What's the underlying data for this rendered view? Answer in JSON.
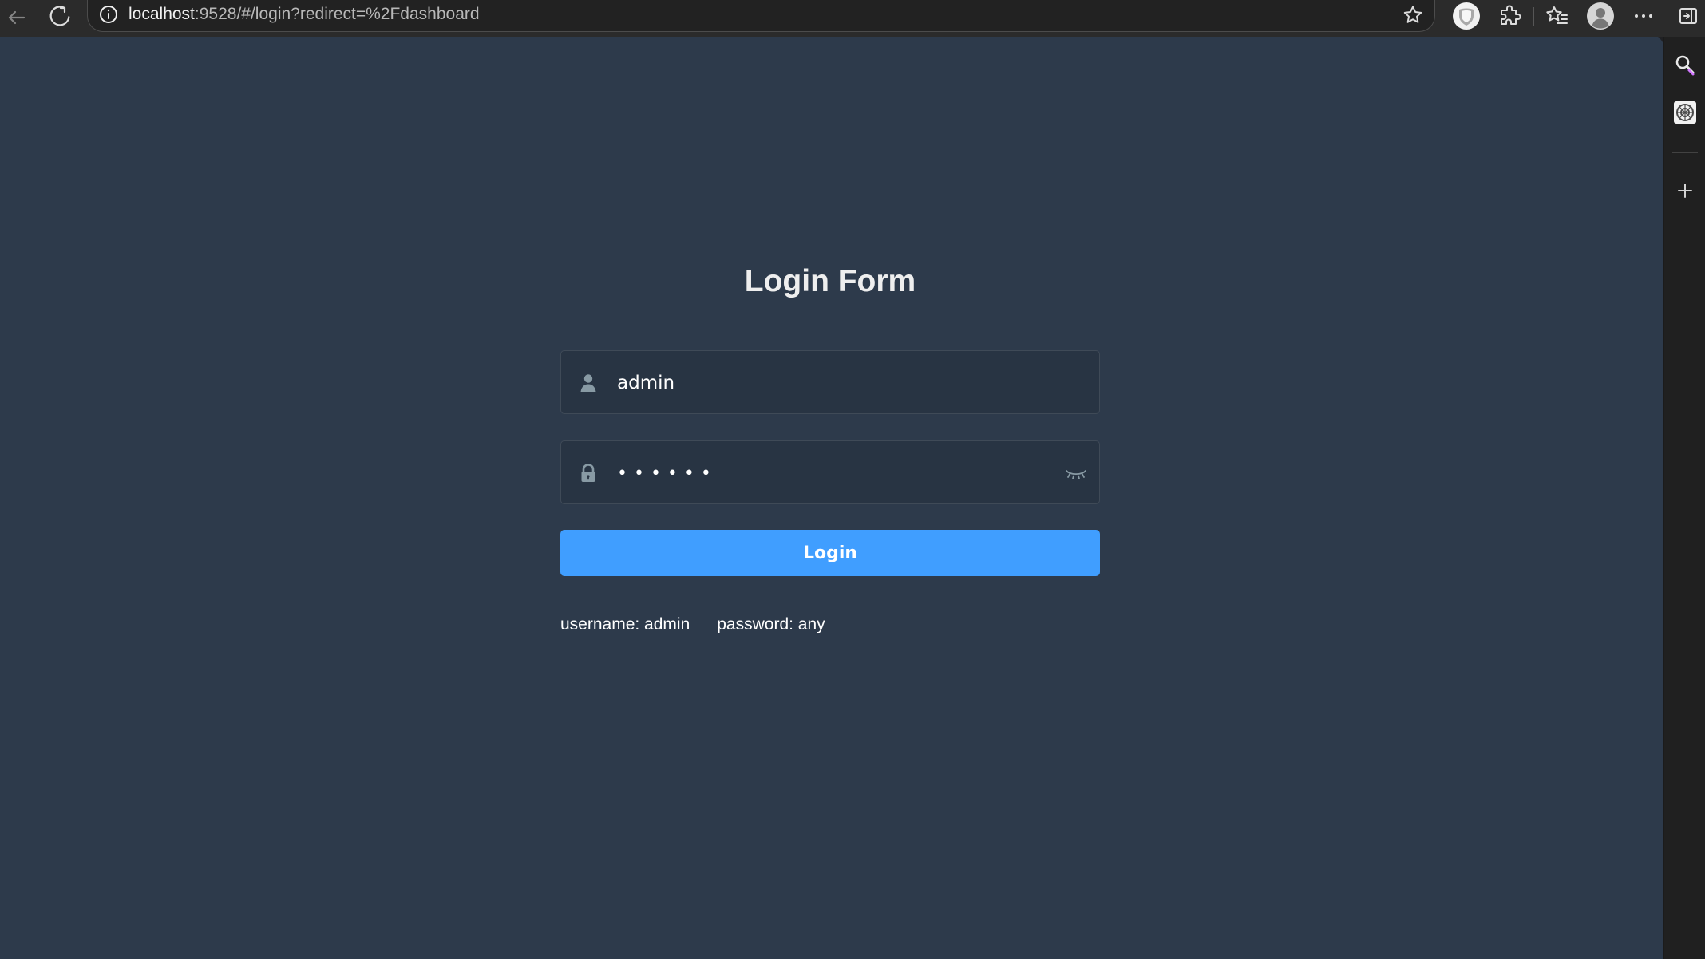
{
  "browser": {
    "url_host": "localhost",
    "url_rest": ":9528/#/login?redirect=%2Fdashboard",
    "icons": {
      "back": "back-arrow-icon",
      "reload": "reload-icon",
      "site_info": "info-circle-icon",
      "favorite": "star-icon",
      "extension_one": "shield-extension-icon",
      "extension_two": "puzzle-icon",
      "collections": "favorites-list-icon",
      "profile": "avatar-icon",
      "more": "more-dots-icon",
      "sidebar_toggle": "sidebar-toggle-icon"
    }
  },
  "sidebar": {
    "icons": {
      "search": "search-icon",
      "app": "app-badge-icon",
      "add": "plus-icon"
    }
  },
  "login": {
    "title": "Login Form",
    "username_value": "admin",
    "password_value": "123456",
    "button_label": "Login",
    "tip_username": "username: admin",
    "tip_password": "password: any"
  },
  "colors": {
    "page_background": "#2d3a4b",
    "input_background": "#283443",
    "primary_button": "#409eff",
    "icon_gray": "#889aa4",
    "browser_chrome": "#2b2b2b"
  }
}
